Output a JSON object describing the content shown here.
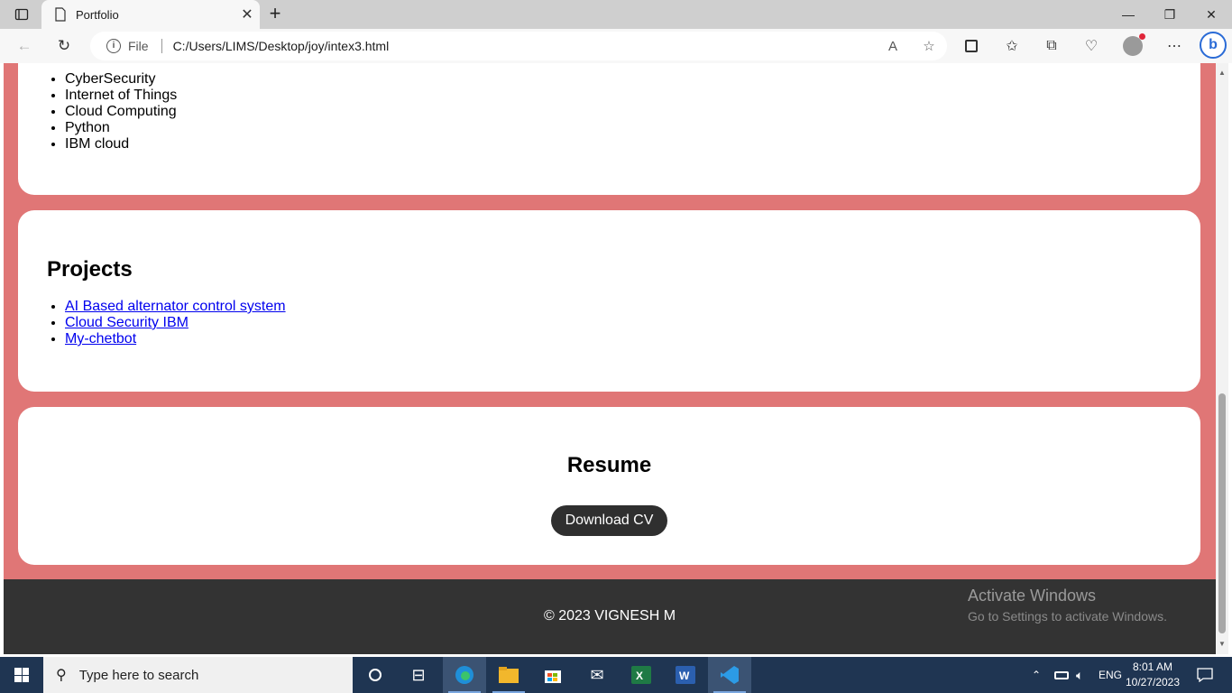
{
  "browser": {
    "tab_title": "Portfolio",
    "new_tab_symbol": "+",
    "file_label": "File",
    "url": "C:/Users/LIMS/Desktop/joy/intex3.html",
    "bing_label": "b"
  },
  "page": {
    "skills": [
      "CyberSecurity",
      "Internet of Things",
      "Cloud Computing",
      "Python",
      "IBM cloud"
    ],
    "projects_heading": "Projects",
    "projects": [
      "AI Based alternator control system",
      "Cloud Security IBM",
      "My-chetbot"
    ],
    "resume_heading": "Resume",
    "download_label": "Download CV",
    "footer_text": "© 2023 VIGNESH M"
  },
  "watermark": {
    "title": "Activate Windows",
    "subtitle": "Go to Settings to activate Windows."
  },
  "taskbar": {
    "search_placeholder": "Type here to search",
    "language": "ENG",
    "time": "8:01 AM",
    "date": "10/27/2023"
  },
  "colors": {
    "page_background": "#e07676",
    "card": "#ffffff",
    "footer": "#333333",
    "button": "#2f2f2f",
    "link": "#0000ee",
    "taskbar": "#1f3552"
  }
}
